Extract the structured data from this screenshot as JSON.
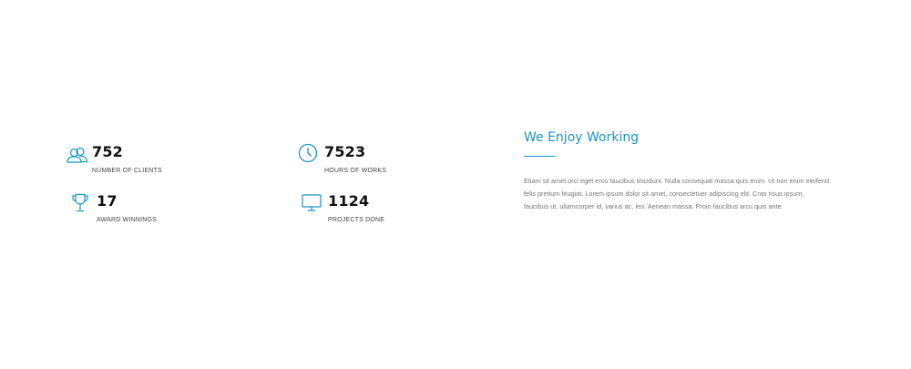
{
  "stats": [
    {
      "icon": "users-icon",
      "value": "752",
      "label": "NUMBER OF CLIENTS"
    },
    {
      "icon": "clock-icon",
      "value": "7523",
      "label": "HOURS OF WORKS"
    },
    {
      "icon": "trophy-icon",
      "value": "17",
      "label": "AWARD WINNINGS"
    },
    {
      "icon": "monitor-icon",
      "value": "1124",
      "label": "PROJECTS DONE"
    }
  ],
  "about": {
    "title": "We Enjoy Working",
    "body": "Etiam sit amet orci eget eros faucibus tincidunt. Nulla consequat massa quis enim. Ut non enim eleifend felis pretium feugiat. Lorem ipsum dolor sit amet, consectetuer adipiscing elit. Cras risus ipsum, faucibus ut, ullamcorper id, varius ac, leo. Aenean massa. Proin faucibus arcu quis ante."
  },
  "colors": {
    "accent": "#1a94c4",
    "value_text": "#111111",
    "label_text": "#444444",
    "body_text": "#777777",
    "background": "#ffffff"
  }
}
